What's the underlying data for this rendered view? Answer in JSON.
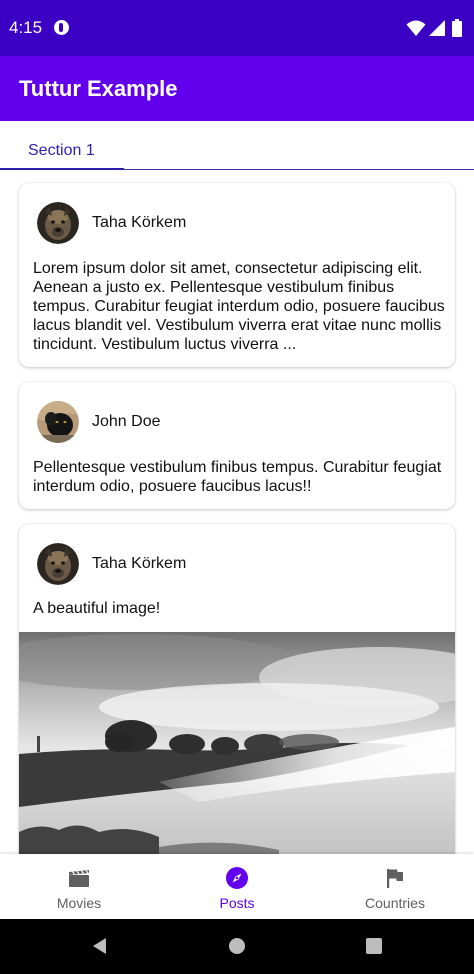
{
  "status_bar": {
    "time": "4:15",
    "background": "#3c00c4",
    "icons": [
      "app-notification-icon",
      "wifi-icon",
      "signal-icon",
      "battery-icon"
    ]
  },
  "app_bar": {
    "title": "Tuttur Example",
    "background": "#6200ee"
  },
  "tabs": [
    {
      "label": "Section 1",
      "selected": true
    }
  ],
  "posts": [
    {
      "author": "Taha Körkem",
      "avatar": "dog-avatar",
      "text": "Lorem ipsum dolor sit amet, consectetur adipiscing elit. Aenean a justo ex. Pellentesque vestibulum finibus tempus. Curabitur feugiat interdum odio, posuere faucibus lacus blandit vel. Vestibulum viverra erat vitae nunc mollis tincidunt. Vestibulum luctus viverra ..."
    },
    {
      "author": "John Doe",
      "avatar": "panther-avatar",
      "text": "Pellentesque vestibulum finibus tempus. Curabitur feugiat interdum odio, posuere faucibus lacus!!"
    },
    {
      "author": "Taha Körkem",
      "avatar": "dog-avatar",
      "text": "A beautiful image!",
      "image": "misty-landscape-photo"
    }
  ],
  "bottom_nav": {
    "items": [
      {
        "label": "Movies",
        "icon": "clapperboard-icon",
        "selected": false
      },
      {
        "label": "Posts",
        "icon": "compass-icon",
        "selected": true
      },
      {
        "label": "Countries",
        "icon": "flag-icon",
        "selected": false
      }
    ],
    "active_color": "#6200ee",
    "inactive_color": "#5f5f5f"
  },
  "system_nav": {
    "buttons": [
      "back-icon",
      "home-icon",
      "recents-icon"
    ]
  }
}
